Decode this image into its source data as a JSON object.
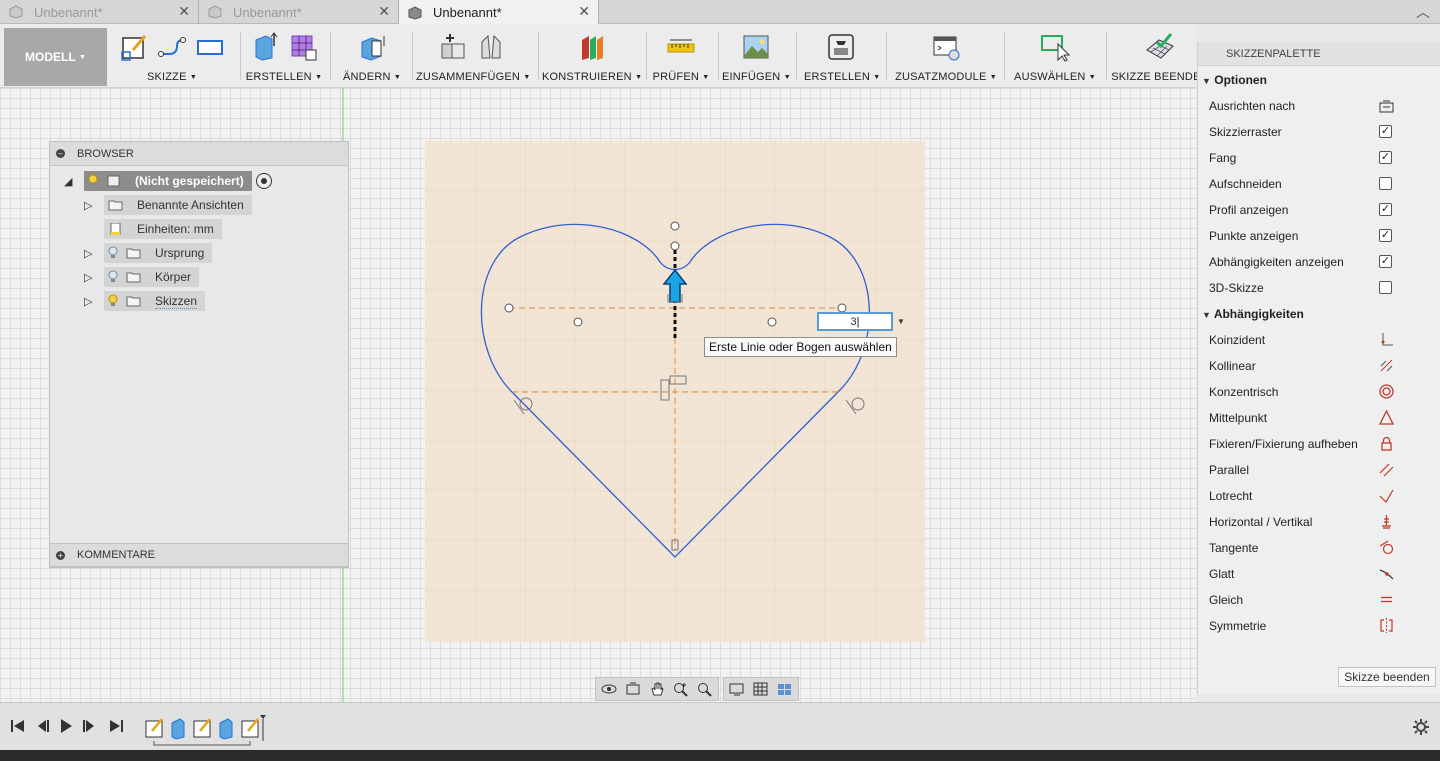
{
  "tabs": [
    {
      "label": "Unbenannt*",
      "active": false
    },
    {
      "label": "Unbenannt*",
      "active": false
    },
    {
      "label": "Unbenannt*",
      "active": true
    }
  ],
  "toolbar": {
    "modell": "MODELL",
    "groups": [
      "SKIZZE",
      "ERSTELLEN",
      "ÄNDERN",
      "ZUSAMMENFÜGEN",
      "KONSTRUIEREN",
      "PRÜFEN",
      "EINFÜGEN",
      "ERSTELLEN",
      "ZUSATZMODULE",
      "AUSWÄHLEN",
      "SKIZZE BEENDEN"
    ]
  },
  "browser": {
    "title": "BROWSER",
    "root": "(Nicht gespeichert)",
    "items": [
      "Benannte Ansichten",
      "Einheiten: mm",
      "Ursprung",
      "Körper",
      "Skizzen"
    ],
    "comments": "KOMMENTARE"
  },
  "palette": {
    "title": "SKIZZENPALETTE",
    "options_title": "Optionen",
    "options": [
      {
        "label": "Ausrichten nach",
        "control": "icon"
      },
      {
        "label": "Skizzierraster",
        "checked": true
      },
      {
        "label": "Fang",
        "checked": true
      },
      {
        "label": "Aufschneiden",
        "checked": false
      },
      {
        "label": "Profil anzeigen",
        "checked": true
      },
      {
        "label": "Punkte anzeigen",
        "checked": true
      },
      {
        "label": "Abhängigkeiten anzeigen",
        "checked": true
      },
      {
        "label": "3D-Skizze",
        "checked": false
      }
    ],
    "constraints_title": "Abhängigkeiten",
    "constraints": [
      "Koinzident",
      "Kollinear",
      "Konzentrisch",
      "Mittelpunkt",
      "Fixieren/Fixierung aufheben",
      "Parallel",
      "Lotrecht",
      "Horizontal / Vertikal",
      "Tangente",
      "Glatt",
      "Gleich",
      "Symmetrie"
    ],
    "finish_button": "Skizze beenden"
  },
  "dimension_input": {
    "value": "3"
  },
  "tooltip": "Erste Linie oder Bogen auswählen",
  "colors": {
    "accent": "#2b6fd6",
    "constraint_red": "#c0392b",
    "sketch_line": "#2f5fd0",
    "plane": "#f3e3d1"
  }
}
